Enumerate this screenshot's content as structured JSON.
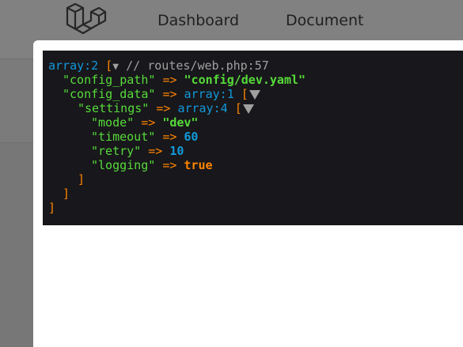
{
  "nav": {
    "logo_icon": "laravel-logo-icon",
    "links": [
      "Dashboard",
      "Document"
    ]
  },
  "dump": {
    "root_type": "array:2",
    "root_open": "[",
    "root_close": "]",
    "comment": "// routes/web.php:57",
    "config_path_key": "\"config_path\"",
    "config_path_value": "\"config/dev.yaml\"",
    "config_data_key": "\"config_data\"",
    "config_data_type": "array:1",
    "settings_key": "\"settings\"",
    "settings_type": "array:4",
    "arrow": "=>",
    "items": [
      {
        "key": "\"mode\"",
        "value": "\"dev\"",
        "kind": "str"
      },
      {
        "key": "\"timeout\"",
        "value": "60",
        "kind": "num"
      },
      {
        "key": "\"retry\"",
        "value": "10",
        "kind": "num"
      },
      {
        "key": "\"logging\"",
        "value": "true",
        "kind": "const"
      }
    ],
    "colors": {
      "background": "#18171b",
      "punctuation": "#ff8400",
      "type": "#1299da",
      "string": "#56db3a",
      "comment": "#a0a0a0"
    }
  }
}
